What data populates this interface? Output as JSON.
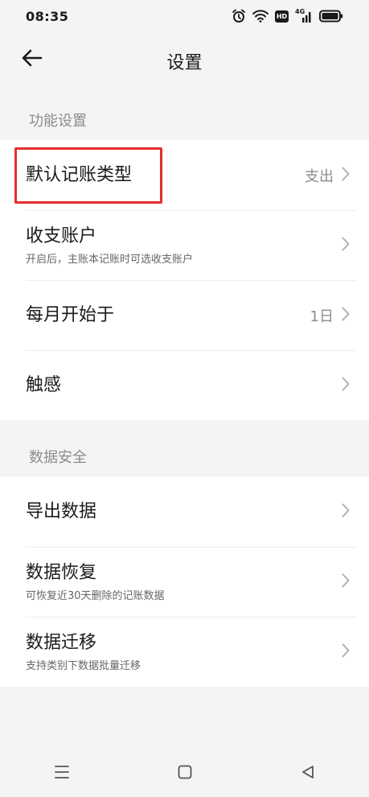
{
  "status": {
    "time": "08:35",
    "hd_label": "HD",
    "network_label": "4G"
  },
  "header": {
    "title": "设置"
  },
  "sections": [
    {
      "title": "功能设置",
      "items": [
        {
          "title": "默认记账类型",
          "value": "支出"
        },
        {
          "title": "收支账户",
          "subtitle": "开启后，主账本记账时可选收支账户"
        },
        {
          "title": "每月开始于",
          "value": "1日"
        },
        {
          "title": "触感"
        }
      ]
    },
    {
      "title": "数据安全",
      "items": [
        {
          "title": "导出数据"
        },
        {
          "title": "数据恢复",
          "subtitle": "可恢复近30天删除的记账数据"
        },
        {
          "title": "数据迁移",
          "subtitle": "支持类别下数据批量迁移"
        }
      ]
    }
  ],
  "colors": {
    "highlight": "#e52e2e",
    "background": "#f4f4f4",
    "card": "#ffffff"
  }
}
